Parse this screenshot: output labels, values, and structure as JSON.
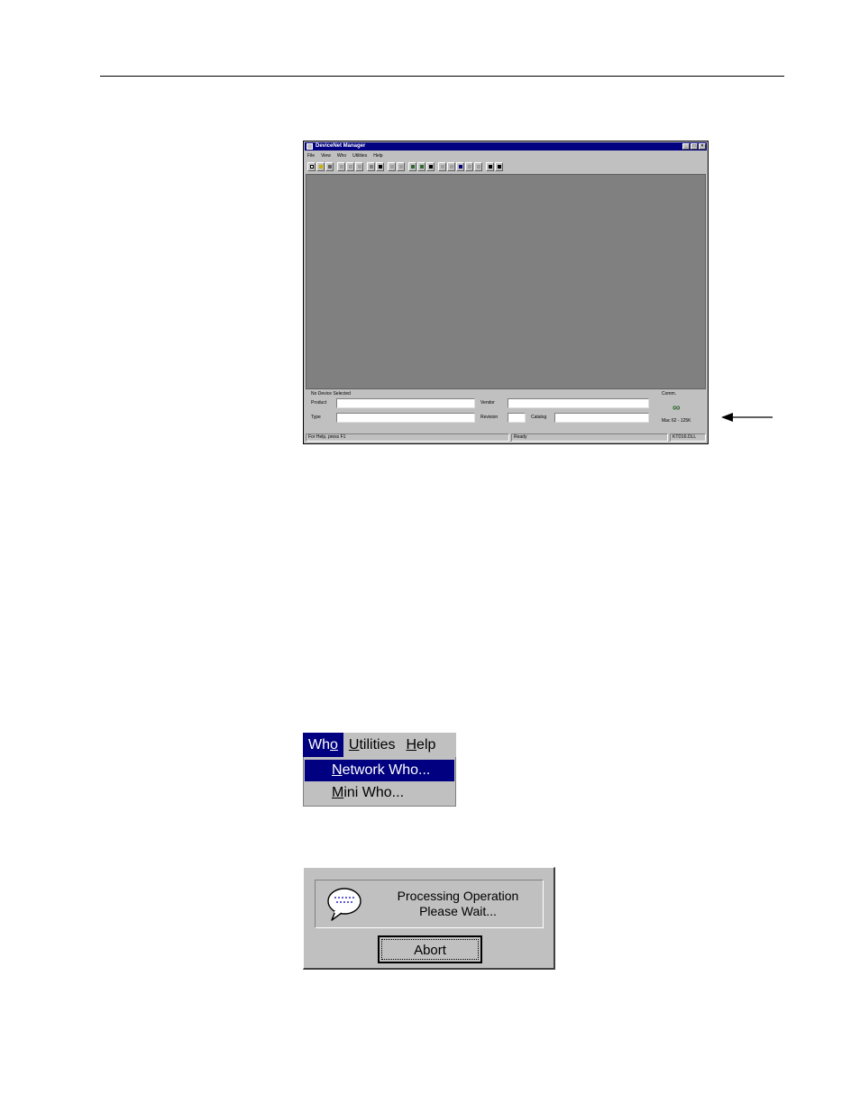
{
  "app": {
    "title": "DeviceNet Manager",
    "menu": [
      "File",
      "View",
      "Who",
      "Utilities",
      "Help"
    ],
    "window_buttons": [
      "_",
      "□",
      "×"
    ],
    "device_panel": {
      "heading": "No Device Selected",
      "product_label": "Product",
      "product_value": "",
      "type_label": "Type",
      "type_value": "",
      "vendor_label": "Vendor",
      "vendor_value": "",
      "revision_label": "Revision",
      "revision_value": "",
      "catalog_label": "Catalog",
      "catalog_value": "",
      "comm_label": "Comm.",
      "comm_status": "Mac 62 - 125K"
    },
    "status": {
      "help": "For Help, press F1",
      "state": "Ready",
      "driver": "KTD16.DLL"
    }
  },
  "who_menu": {
    "top_items": [
      {
        "prefix": "Wh",
        "hotkey": "o",
        "suffix": ""
      },
      {
        "prefix": "",
        "hotkey": "U",
        "suffix": "tilities"
      },
      {
        "prefix": "",
        "hotkey": "H",
        "suffix": "elp"
      }
    ],
    "items": [
      {
        "hotkey": "N",
        "rest": "etwork Who..."
      },
      {
        "hotkey": "M",
        "rest": "ini Who..."
      }
    ]
  },
  "processing_dialog": {
    "line1": "Processing Operation",
    "line2": "Please Wait...",
    "abort_label": "Abort"
  },
  "colors": {
    "titlebar": "#000080",
    "face": "#c0c0c0",
    "client": "#808080",
    "highlight": "#000080"
  }
}
